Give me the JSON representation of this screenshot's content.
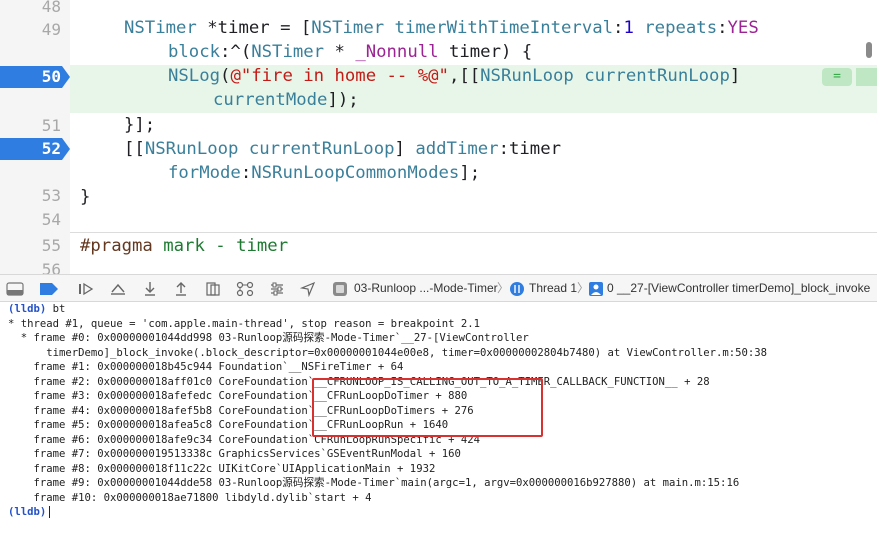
{
  "editor": {
    "lines": [
      {
        "num": "48"
      },
      {
        "num": "49"
      },
      {
        "num": "50",
        "breakpoint": true
      },
      {
        "num": "51"
      },
      {
        "num": "52",
        "breakpoint": true
      },
      {
        "num": "53"
      },
      {
        "num": "54"
      },
      {
        "num": "55"
      },
      {
        "num": "56"
      }
    ],
    "code": {
      "l49a_cls": "NSTimer",
      "l49a_rest": " *timer = [",
      "l49a_cls2": "NSTimer",
      "l49a_sp": " ",
      "l49a_fn": "timerWithTimeInterval",
      "l49a_colon": ":",
      "l49a_num": "1",
      "l49a_sp2": " ",
      "l49a_fn2": "repeats",
      "l49a_colon2": ":",
      "l49a_kw": "YES",
      "l49b_fn": "block",
      "l49b_rest": ":^(",
      "l49b_cls": "NSTimer",
      "l49b_rest2": " * ",
      "l49b_kw": "_Nonnull",
      "l49b_rest3": " timer) {",
      "l50a_fn": "NSLog",
      "l50a_rest": "(",
      "l50a_str": "@\"fire in home -- %@\"",
      "l50a_rest2": ",[[",
      "l50a_cls": "NSRunLoop",
      "l50a_sp": " ",
      "l50a_fn2": "currentRunLoop",
      "l50a_rest3": "]",
      "l50b_fn": "currentMode",
      "l50b_rest": "]);",
      "l51": "}];",
      "l52a_rest": "[[",
      "l52a_cls": "NSRunLoop",
      "l52a_sp": " ",
      "l52a_fn": "currentRunLoop",
      "l52a_rest2": "] ",
      "l52a_fn2": "addTimer",
      "l52a_rest3": ":timer",
      "l52b_fn": "forMode",
      "l52b_rest": ":",
      "l52b_cls": "NSRunLoopCommonModes",
      "l52b_rest2": "];",
      "l53": "}",
      "l55_pp": "#pragma",
      "l55_mark": " mark - timer"
    },
    "change_badge": "="
  },
  "debug_bar": {
    "crumb_target": "03-Runloop ...-Mode-Timer",
    "crumb_thread": "Thread 1",
    "crumb_frame": "0 __27-[ViewController timerDemo]_block_invoke",
    "separator": "〉"
  },
  "console": {
    "prompt": "(lldb)",
    "lines": [
      {
        "prompt": true,
        "text": " bt"
      },
      {
        "text": "* thread #1, queue = 'com.apple.main-thread', stop reason = breakpoint 2.1"
      },
      {
        "text": "  * frame #0: 0x00000001044dd998 03-Runloop源码探索-Mode-Timer`__27-[ViewController"
      },
      {
        "text": "      timerDemo]_block_invoke(.block_descriptor=0x00000001044e00e8, timer=0x00000002804b7480) at ViewController.m:50:38"
      },
      {
        "text": "    frame #1: 0x000000018b45c944 Foundation`__NSFireTimer + 64"
      },
      {
        "text": "    frame #2: 0x000000018aff01c0 CoreFoundation`__CFRUNLOOP_IS_CALLING_OUT_TO_A_TIMER_CALLBACK_FUNCTION__ + 28"
      },
      {
        "text": "    frame #3: 0x000000018afefedc CoreFoundation`__CFRunLoopDoTimer + 880"
      },
      {
        "text": "    frame #4: 0x000000018afef5b8 CoreFoundation`__CFRunLoopDoTimers + 276"
      },
      {
        "text": "    frame #5: 0x000000018afea5c8 CoreFoundation`__CFRunLoopRun + 1640"
      },
      {
        "text": "    frame #6: 0x000000018afe9c34 CoreFoundation`CFRunLoopRunSpecific + 424"
      },
      {
        "text": "    frame #7: 0x000000019513338c GraphicsServices`GSEventRunModal + 160"
      },
      {
        "text": "    frame #8: 0x000000018f11c22c UIKitCore`UIApplicationMain + 1932"
      },
      {
        "text": "    frame #9: 0x00000001044dde58 03-Runloop源码探索-Mode-Timer`main(argc=1, argv=0x000000016b927880) at main.m:15:16"
      },
      {
        "text": "    frame #10: 0x000000018ae71800 libdyld.dylib`start + 4"
      },
      {
        "prompt": true,
        "text": " ",
        "caret": true
      }
    ]
  },
  "colors": {
    "breakpoint": "#2f7de1",
    "highlight": "#e7f6e9",
    "annotation_box": "#d93030",
    "prompt": "#2451c7"
  }
}
